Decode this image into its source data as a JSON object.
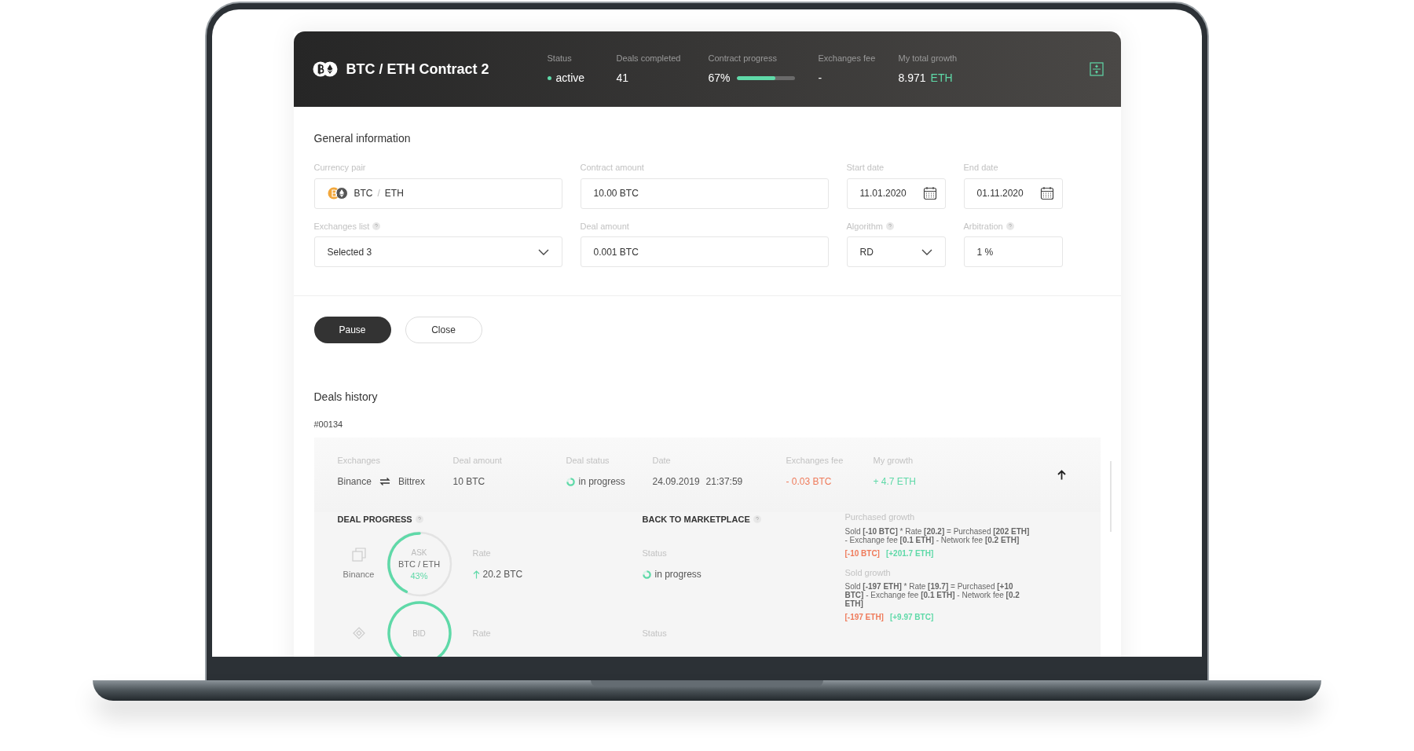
{
  "header": {
    "title": "BTC / ETH Contract 2",
    "stats": [
      {
        "kind": "status",
        "label": "Status",
        "value": "active"
      },
      {
        "kind": "text",
        "label": "Deals completed",
        "value": "41"
      },
      {
        "kind": "progress",
        "label": "Contract progress",
        "value": "67%",
        "level": 0.67
      },
      {
        "kind": "text",
        "label": "Exchanges fee",
        "value": "-"
      },
      {
        "kind": "growth",
        "label": "My total growth",
        "value": "8.971",
        "unit": "ETH"
      }
    ]
  },
  "general": {
    "title": "General information",
    "fields": [
      {
        "kind": "pair",
        "label": "Currency pair",
        "base": "BTC",
        "separator": "/",
        "quote": "ETH",
        "help": false
      },
      {
        "kind": "text",
        "label": "Contract amount",
        "value": "10.00 BTC",
        "help": false
      },
      {
        "kind": "date",
        "label": "Start date",
        "value": "11.01.2020",
        "help": false
      },
      {
        "kind": "date",
        "label": "End date",
        "value": "01.11.2020",
        "help": false
      },
      {
        "kind": "select",
        "label": "Exchanges list",
        "value": "Selected 3",
        "help": true
      },
      {
        "kind": "text",
        "label": "Deal amount",
        "value": "0.001 BTC",
        "help": false
      },
      {
        "kind": "select",
        "label": "Algorithm",
        "value": "RD",
        "help": true
      },
      {
        "kind": "text",
        "label": "Arbitration",
        "value": "1 %",
        "help": true
      }
    ]
  },
  "buttons": [
    {
      "label": "Pause",
      "primary": true
    },
    {
      "label": "Close",
      "primary": false
    }
  ],
  "history": {
    "title": "Deals history",
    "deal_id": "#00134",
    "summary": {
      "exchanges_label": "Exchanges",
      "from": "Binance",
      "to": "Bittrex",
      "amount_label": "Deal amount",
      "amount": "10 BTC",
      "status_label": "Deal status",
      "status": "in progress",
      "date_label": "Date",
      "date": "24.09.2019",
      "time": "21:37:59",
      "fee_label": "Exchanges fee",
      "fee": "- 0.03 BTC",
      "growth_label": "My growth",
      "growth": "+ 4.7 ETH"
    },
    "progress_title": "DEAL PROGRESS",
    "marketplace_title": "BACK TO MARKETPLACE",
    "progress_rows": [
      {
        "exchange": "Binance",
        "side": "ASK",
        "pair": "BTC / ETH",
        "percent": "43%",
        "level": 0.43,
        "rate_label": "Rate",
        "rate": "20.2 BTC",
        "status_label": "Status",
        "status": "in progress"
      },
      {
        "side": "BID",
        "level": 1,
        "rate_label": "Rate",
        "status_label": "Status"
      }
    ],
    "growth_blocks": [
      {
        "label": "Purchased growth",
        "formula": "Sold **[-10 BTC]** * Rate **[20.2]** = Purchased **[202 ETH]** - Exchange fee **[0.1 ETH]** - Network fee **[0.2 ETH]**",
        "loss": "[-10 BTC]",
        "gain": "[+201.7 ETH]"
      },
      {
        "label": "Sold growth",
        "formula": "Sold **[-197 ETH]** * Rate **[19.7]** = Purchased **[+10 BTC]** - Exchange fee **[0.1 ETH]** - Network fee **[0.2 ETH]**",
        "loss": "[-197 ETH]",
        "gain": "[+9.97 BTC]"
      }
    ]
  }
}
